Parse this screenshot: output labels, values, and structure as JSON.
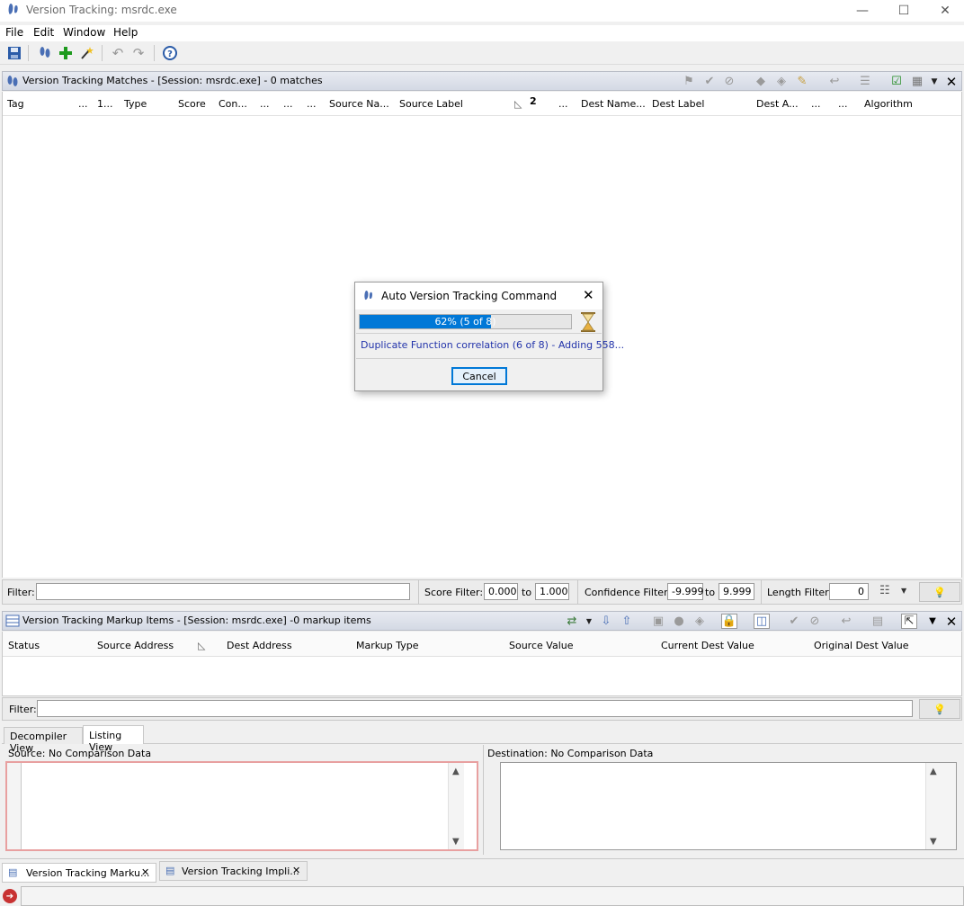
{
  "window": {
    "title": "Version Tracking: msrdc.exe",
    "min": "—",
    "max": "☐",
    "close": "✕"
  },
  "menu": [
    "File",
    "Edit",
    "Window",
    "Help"
  ],
  "matches_panel": {
    "title": "Version Tracking Matches - [Session: msrdc.exe] - 0 matches",
    "columns": [
      "Tag",
      "...",
      "1...",
      "Type",
      "Score",
      "Con...",
      "...",
      "...",
      "...",
      "Source Na...",
      "Source Label",
      "2",
      "...",
      "Dest Name...",
      "Dest Label",
      "Dest A...",
      "...",
      "...",
      "Algorithm"
    ],
    "filter_label": "Filter:",
    "score_filter_label": "Score Filter:",
    "score_min": "0.000",
    "score_to": "to",
    "score_max": "1.000",
    "conf_filter_label": "Confidence Filter:",
    "conf_min": "-9.999",
    "conf_to": "to",
    "conf_max": "9.999",
    "length_filter_label": "Length Filter:",
    "length_value": "0"
  },
  "markup_panel": {
    "title": "Version Tracking Markup Items - [Session: msrdc.exe] -0 markup items",
    "columns": [
      "Status",
      "Source Address",
      "Dest Address",
      "Markup Type",
      "Source Value",
      "Current Dest Value",
      "Original Dest Value"
    ],
    "filter_label": "Filter:"
  },
  "view_tabs": [
    "Decompiler View",
    "Listing View"
  ],
  "source_label": "Source: No Comparison Data",
  "dest_label": "Destination: No Comparison Data",
  "bottom_tabs": [
    "Version Tracking Marku...",
    "Version Tracking Impli..."
  ],
  "dialog": {
    "title": "Auto Version Tracking Command",
    "progress_text": "62% (5 of 8)",
    "progress_fraction": 0.62,
    "message": "Duplicate Function correlation (6 of 8) - Adding 558...",
    "cancel": "Cancel"
  },
  "colors": {
    "accent": "#0078d7",
    "link_text": "#2233aa",
    "error_border": "#e8a0a0"
  }
}
